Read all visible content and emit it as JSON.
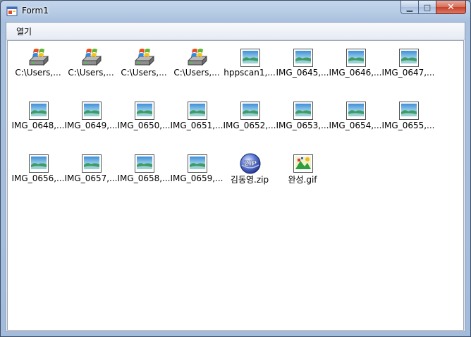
{
  "window": {
    "title": "Form1",
    "minimize_glyph": "▁",
    "maximize_glyph": "□",
    "close_glyph": "✕"
  },
  "menu": {
    "items": [
      {
        "label": "열기"
      }
    ]
  },
  "files": [
    {
      "label": "C:\\Users,...",
      "icon": "drive-icon"
    },
    {
      "label": "C:\\Users,...",
      "icon": "drive-icon"
    },
    {
      "label": "C:\\Users,...",
      "icon": "drive-icon"
    },
    {
      "label": "C:\\Users,...",
      "icon": "drive-icon"
    },
    {
      "label": "hppscan1,...",
      "icon": "image-file-icon"
    },
    {
      "label": "IMG_0645,...",
      "icon": "image-file-icon"
    },
    {
      "label": "IMG_0646,...",
      "icon": "image-file-icon"
    },
    {
      "label": "IMG_0647,...",
      "icon": "image-file-icon"
    },
    {
      "label": "IMG_0648,...",
      "icon": "image-file-icon"
    },
    {
      "label": "IMG_0649,...",
      "icon": "image-file-icon"
    },
    {
      "label": "IMG_0650,...",
      "icon": "image-file-icon"
    },
    {
      "label": "IMG_0651,...",
      "icon": "image-file-icon"
    },
    {
      "label": "IMG_0652,...",
      "icon": "image-file-icon"
    },
    {
      "label": "IMG_0653,...",
      "icon": "image-file-icon"
    },
    {
      "label": "IMG_0654,...",
      "icon": "image-file-icon"
    },
    {
      "label": "IMG_0655,...",
      "icon": "image-file-icon"
    },
    {
      "label": "IMG_0656,...",
      "icon": "image-file-icon"
    },
    {
      "label": "IMG_0657,...",
      "icon": "image-file-icon"
    },
    {
      "label": "IMG_0658,...",
      "icon": "image-file-icon"
    },
    {
      "label": "IMG_0659,...",
      "icon": "image-file-icon"
    },
    {
      "label": "김동영.zip",
      "icon": "zip-file-icon"
    },
    {
      "label": "완성.gif",
      "icon": "gif-file-icon"
    }
  ],
  "colors": {
    "titlebar": "#b9cde6",
    "close_button": "#c74229",
    "list_background": "#ffffff"
  }
}
